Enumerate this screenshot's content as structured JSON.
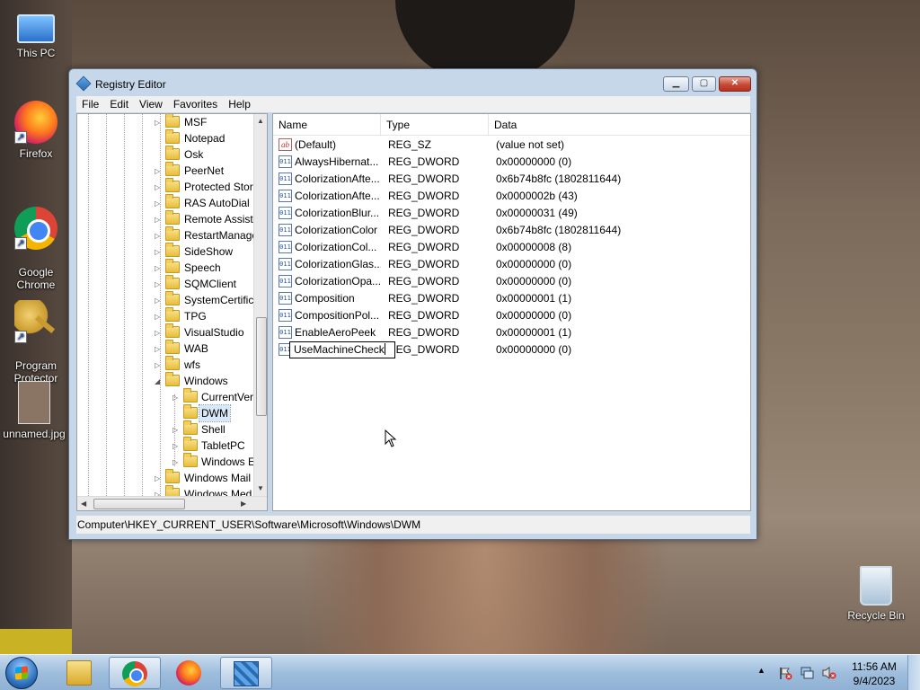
{
  "desktop": {
    "icons": [
      {
        "label": "This PC"
      },
      {
        "label": "Firefox"
      },
      {
        "label": "Google\nChrome"
      },
      {
        "label": "Program\nProtector"
      },
      {
        "label": "unnamed.jpg"
      },
      {
        "label": "Recycle Bin"
      }
    ]
  },
  "window": {
    "title": "Registry Editor",
    "buttons": {
      "minimize": "▁",
      "maximize": "▢",
      "close": "✕"
    },
    "menu": [
      "File",
      "Edit",
      "View",
      "Favorites",
      "Help"
    ],
    "tree": [
      {
        "label": "MSF"
      },
      {
        "label": "Notepad"
      },
      {
        "label": "Osk"
      },
      {
        "label": "PeerNet"
      },
      {
        "label": "Protected Stor"
      },
      {
        "label": "RAS AutoDial"
      },
      {
        "label": "Remote Assista"
      },
      {
        "label": "RestartManage"
      },
      {
        "label": "SideShow"
      },
      {
        "label": "Speech"
      },
      {
        "label": "SQMClient"
      },
      {
        "label": "SystemCertific"
      },
      {
        "label": "TPG"
      },
      {
        "label": "VisualStudio"
      },
      {
        "label": "WAB"
      },
      {
        "label": "wfs"
      },
      {
        "label": "Windows"
      },
      {
        "label": "CurrentVer"
      },
      {
        "label": "DWM"
      },
      {
        "label": "Shell"
      },
      {
        "label": "TabletPC"
      },
      {
        "label": "Windows E"
      },
      {
        "label": "Windows Mail"
      },
      {
        "label": "Windows Med"
      }
    ],
    "list": {
      "columns": [
        "Name",
        "Type",
        "Data"
      ],
      "rows": [
        {
          "icon": "ab",
          "name": "(Default)",
          "type": "REG_SZ",
          "data": "(value not set)"
        },
        {
          "icon": "011",
          "name": "AlwaysHibernat...",
          "type": "REG_DWORD",
          "data": "0x00000000 (0)"
        },
        {
          "icon": "011",
          "name": "ColorizationAfte...",
          "type": "REG_DWORD",
          "data": "0x6b74b8fc (1802811644)"
        },
        {
          "icon": "011",
          "name": "ColorizationAfte...",
          "type": "REG_DWORD",
          "data": "0x0000002b (43)"
        },
        {
          "icon": "011",
          "name": "ColorizationBlur...",
          "type": "REG_DWORD",
          "data": "0x00000031 (49)"
        },
        {
          "icon": "011",
          "name": "ColorizationColor",
          "type": "REG_DWORD",
          "data": "0x6b74b8fc (1802811644)"
        },
        {
          "icon": "011",
          "name": "ColorizationCol...",
          "type": "REG_DWORD",
          "data": "0x00000008 (8)"
        },
        {
          "icon": "011",
          "name": "ColorizationGlas...",
          "type": "REG_DWORD",
          "data": "0x00000000 (0)"
        },
        {
          "icon": "011",
          "name": "ColorizationOpa...",
          "type": "REG_DWORD",
          "data": "0x00000000 (0)"
        },
        {
          "icon": "011",
          "name": "Composition",
          "type": "REG_DWORD",
          "data": "0x00000001 (1)"
        },
        {
          "icon": "011",
          "name": "CompositionPol...",
          "type": "REG_DWORD",
          "data": "0x00000000 (0)"
        },
        {
          "icon": "011",
          "name": "EnableAeroPeek",
          "type": "REG_DWORD",
          "data": "0x00000001 (1)"
        },
        {
          "icon": "011",
          "name": "UseMachineCheck",
          "type": "REG_DWORD",
          "data": "0x00000000 (0)",
          "editing": true
        }
      ]
    },
    "status_path": "Computer\\HKEY_CURRENT_USER\\Software\\Microsoft\\Windows\\DWM"
  },
  "taskbar": {
    "time": "11:56 AM",
    "date": "9/4/2023",
    "tray_up_arrow": "▲"
  },
  "colors": {
    "title_glass": "#c6d7ea",
    "selection": "#d9e8f8",
    "taskbar": "#9fbedd"
  }
}
